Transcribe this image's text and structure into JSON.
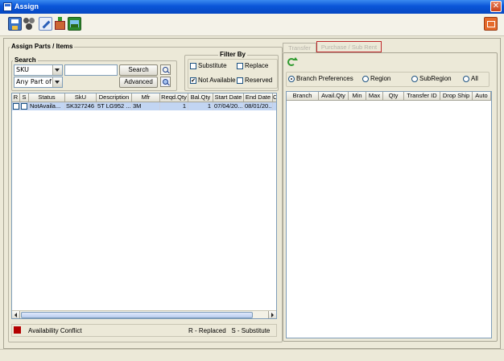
{
  "window": {
    "title": "Assign"
  },
  "toolbar": {
    "buttons": [
      {
        "icon": "save-icon"
      },
      {
        "icon": "group-icon"
      },
      {
        "icon": "edit-icon"
      },
      {
        "icon": "add-item-icon"
      },
      {
        "icon": "image-chart-icon"
      }
    ],
    "exit_icon": "exit-icon"
  },
  "left": {
    "group_title": "Assign Parts / Items",
    "search": {
      "title": "Search",
      "field_select": "SKU",
      "match_select": "Any Part of ...",
      "query_value": "",
      "search_label": "Search",
      "advanced_label": "Advanced"
    },
    "filter": {
      "title": "Filter By",
      "substitute": {
        "label": "Substitute",
        "checked": false
      },
      "replace": {
        "label": "Replace",
        "checked": false
      },
      "not_available": {
        "label": "Not Available",
        "checked": true
      },
      "reserved": {
        "label": "Reserved",
        "checked": false
      }
    },
    "table": {
      "columns": [
        "R",
        "S",
        "Status",
        "SkU",
        "Description",
        "Mfr",
        "Reqd.Qty",
        "Bal.Qty",
        "Start Date",
        "End Date",
        "C"
      ],
      "rows": [
        {
          "r": false,
          "s": false,
          "status": "NotAvaila...",
          "sku": "SK327246",
          "description": "5T LG952 ...",
          "mfr": "3M",
          "reqd_qty": "1",
          "bal_qty": "1",
          "start_date": "07/04/20...",
          "end_date": "08/01/20..."
        }
      ]
    },
    "legend": {
      "conflict_label": "Availability Conflict",
      "conflict_color": "#b40000",
      "key_text": "R - Replaced   S - Substitute"
    }
  },
  "right": {
    "tabs": [
      {
        "label": "Transfer",
        "active": false
      },
      {
        "label": "Purchase / Sub Rent",
        "active": false,
        "highlight": "#c0282c"
      }
    ],
    "refresh_icon": "refresh-icon",
    "radios": [
      {
        "label": "Branch Preferences",
        "selected": true
      },
      {
        "label": "Region",
        "selected": false
      },
      {
        "label": "SubRegion",
        "selected": false
      },
      {
        "label": "All",
        "selected": false
      }
    ],
    "table": {
      "columns": [
        "Branch",
        "Avail.Qty",
        "Min",
        "Max",
        "Qty",
        "Transfer ID",
        "Drop Ship",
        "Auto"
      ]
    }
  },
  "colors": {
    "titlebar": "#0a55d8",
    "selection": "#c2d5f2",
    "window_bg": "#ece9d8"
  }
}
